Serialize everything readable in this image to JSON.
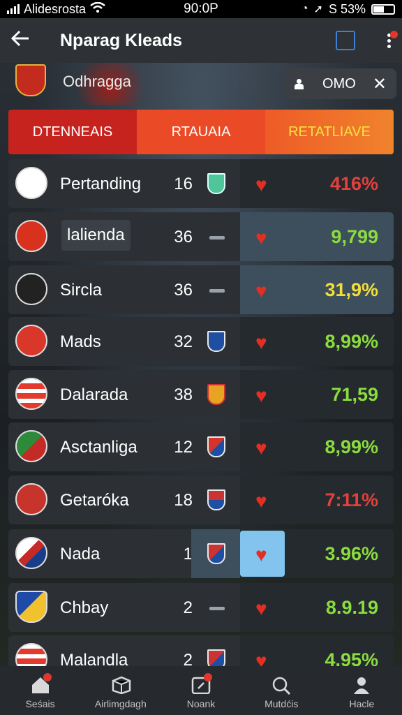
{
  "status_bar": {
    "carrier": "Alidesrosta",
    "time": "90:0P",
    "battery": "S 53%"
  },
  "app_bar": {
    "title": "Nparag Kleads"
  },
  "hero": {
    "name": "Odhragga",
    "pill_label": "OMO"
  },
  "tabs": [
    {
      "label": "DTENNEAIS"
    },
    {
      "label": "RTAUAIA"
    },
    {
      "label": "RETATLIAVE"
    }
  ],
  "rows": [
    {
      "name": "Pertanding",
      "num": "16",
      "pct": "416%",
      "pct_color": "red"
    },
    {
      "name": "lalienda",
      "num": "36",
      "pct": "9,799",
      "pct_color": "green"
    },
    {
      "name": "Sircla",
      "num": "36",
      "pct": "31,9%",
      "pct_color": "yellow"
    },
    {
      "name": "Mads",
      "num": "32",
      "pct": "8,99%",
      "pct_color": "green"
    },
    {
      "name": "Dalarada",
      "num": "38",
      "pct": "71,59",
      "pct_color": "green"
    },
    {
      "name": "Asctanliga",
      "num": "12",
      "pct": "8,99%",
      "pct_color": "green"
    },
    {
      "name": "Getaróka",
      "num": "18",
      "pct": "7:11%",
      "pct_color": "red"
    },
    {
      "name": "Nada",
      "num": "1",
      "pct": "3.96%",
      "pct_color": "green"
    },
    {
      "name": "Chbay",
      "num": "2",
      "pct": "8.9.19",
      "pct_color": "green"
    },
    {
      "name": "Malandla",
      "num": "2",
      "pct": "4.95%",
      "pct_color": "green"
    }
  ],
  "nav": [
    {
      "label": "Seśais",
      "icon": "home-icon"
    },
    {
      "label": "Airlimgdagh",
      "icon": "box-icon"
    },
    {
      "label": "Noank",
      "icon": "edit-icon"
    },
    {
      "label": "Mutdćis",
      "icon": "search-icon"
    },
    {
      "label": "Hacle",
      "icon": "profile-icon"
    }
  ]
}
